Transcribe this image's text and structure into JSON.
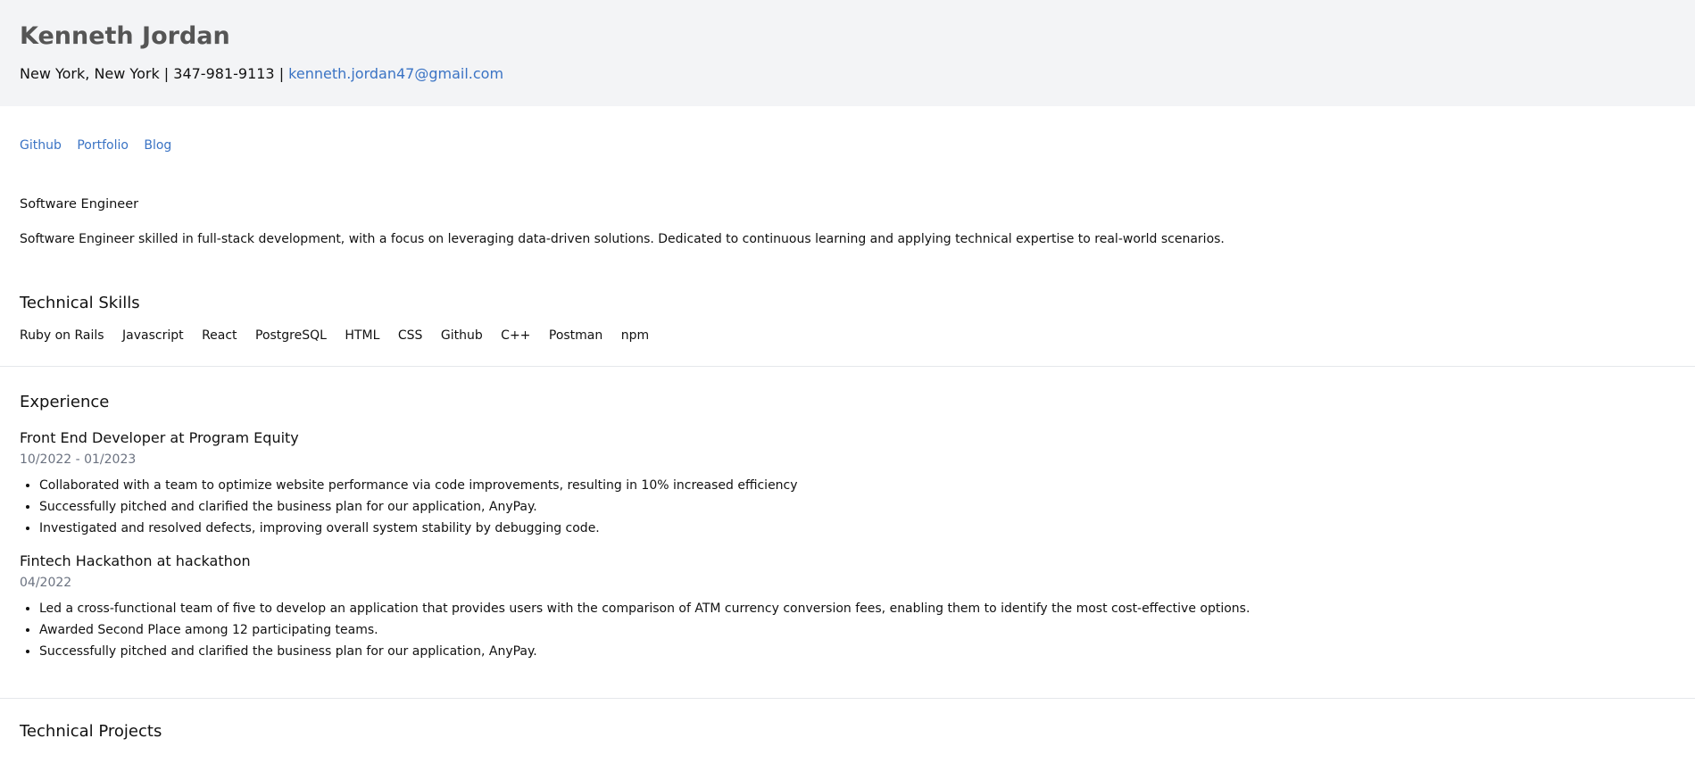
{
  "header": {
    "name": "Kenneth Jordan",
    "location": "New York, New York",
    "separator": " | ",
    "phone": "347-981-9113",
    "email": "kenneth.jordan47@gmail.com"
  },
  "links": [
    "Github",
    "Portfolio",
    "Blog"
  ],
  "summary": {
    "role": "Software Engineer",
    "text": "Software Engineer skilled in full-stack development, with a focus on leveraging data-driven solutions. Dedicated to continuous learning and applying technical expertise to real-world scenarios."
  },
  "skills": {
    "title": "Technical Skills",
    "items": [
      "Ruby on Rails",
      "Javascript",
      "React",
      "PostgreSQL",
      "HTML",
      "CSS",
      "Github",
      "C++",
      "Postman",
      "npm"
    ]
  },
  "experience": {
    "title": "Experience",
    "jobs": [
      {
        "title": "Front End Developer at Program Equity",
        "dates": "10/2022 - 01/2023",
        "bullets": [
          "Collaborated with a team to optimize website performance via code improvements, resulting in 10% increased efficiency",
          "Successfully pitched and clarified the business plan for our application, AnyPay.",
          "Investigated and resolved defects, improving overall system stability by debugging code."
        ]
      },
      {
        "title": "Fintech Hackathon at hackathon",
        "dates": "04/2022",
        "bullets": [
          "Led a cross-functional team of five to develop an application that provides users with the comparison of ATM currency conversion fees, enabling them to identify the most cost-effective options.",
          "Awarded Second Place among 12 participating teams.",
          "Successfully pitched and clarified the business plan for our application, AnyPay."
        ]
      }
    ]
  },
  "projects": {
    "title": "Technical Projects"
  },
  "colors": {
    "link": "#3a73c4",
    "header_bg": "#f3f4f6",
    "muted": "#6b7280"
  }
}
